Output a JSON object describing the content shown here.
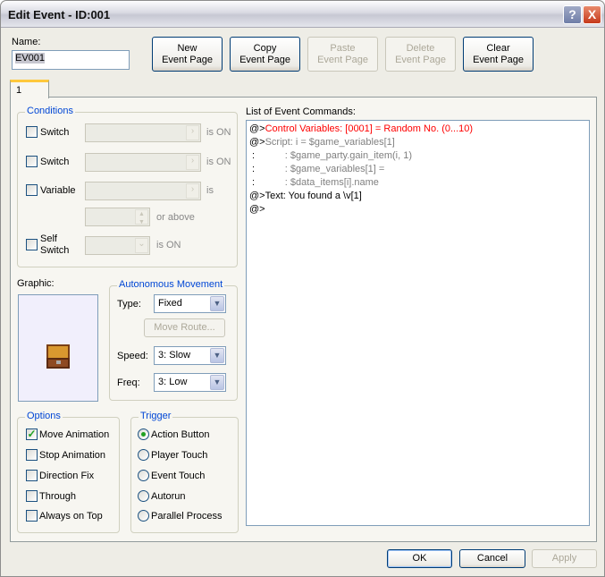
{
  "window": {
    "title": "Edit Event - ID:001",
    "help_icon": "?",
    "close_icon": "X"
  },
  "name": {
    "label": "Name:",
    "value": "EV001"
  },
  "toolbar": {
    "new": "New\nEvent Page",
    "copy": "Copy\nEvent Page",
    "paste": "Paste\nEvent Page",
    "delete": "Delete\nEvent Page",
    "clear": "Clear\nEvent Page"
  },
  "tabs": [
    {
      "label": "1"
    }
  ],
  "conditions": {
    "title": "Conditions",
    "switch1": "Switch",
    "switch2": "Switch",
    "variable": "Variable",
    "self_switch": "Self\nSwitch",
    "is_on": "is ON",
    "is": "is",
    "or_above": "or above"
  },
  "graphic": {
    "label": "Graphic:"
  },
  "movement": {
    "title": "Autonomous Movement",
    "type_label": "Type:",
    "type": "Fixed",
    "move_route": "Move Route...",
    "speed_label": "Speed:",
    "speed": "3: Slow",
    "freq_label": "Freq:",
    "freq": "3: Low"
  },
  "options": {
    "title": "Options",
    "items": [
      {
        "label": "Move Animation",
        "checked": true
      },
      {
        "label": "Stop Animation",
        "checked": false
      },
      {
        "label": "Direction Fix",
        "checked": false
      },
      {
        "label": "Through",
        "checked": false
      },
      {
        "label": "Always on Top",
        "checked": false
      }
    ]
  },
  "trigger": {
    "title": "Trigger",
    "items": [
      {
        "label": "Action Button",
        "selected": true
      },
      {
        "label": "Player Touch",
        "selected": false
      },
      {
        "label": "Event Touch",
        "selected": false
      },
      {
        "label": "Autorun",
        "selected": false
      },
      {
        "label": "Parallel Process",
        "selected": false
      }
    ]
  },
  "commands": {
    "label": "List of Event Commands:",
    "lines": [
      {
        "prefix": "@>",
        "text": "Control Variables: [0001] = Random No. (0...10)",
        "color": "#ff0000"
      },
      {
        "prefix": "@>",
        "text": "Script: i = $game_variables[1]",
        "color": "#808080"
      },
      {
        "prefix": " :",
        "text": "           : $game_party.gain_item(i, 1)",
        "color": "#808080"
      },
      {
        "prefix": " :",
        "text": "           : $game_variables[1] =",
        "color": "#808080"
      },
      {
        "prefix": " :",
        "text": "           : $data_items[i].name",
        "color": "#808080"
      },
      {
        "prefix": "@>",
        "text": "Text: You found a \\v[1]",
        "color": "#000000"
      },
      {
        "prefix": "@>",
        "text": "",
        "color": "#000000"
      }
    ]
  },
  "footer": {
    "ok": "OK",
    "cancel": "Cancel",
    "apply": "Apply"
  }
}
